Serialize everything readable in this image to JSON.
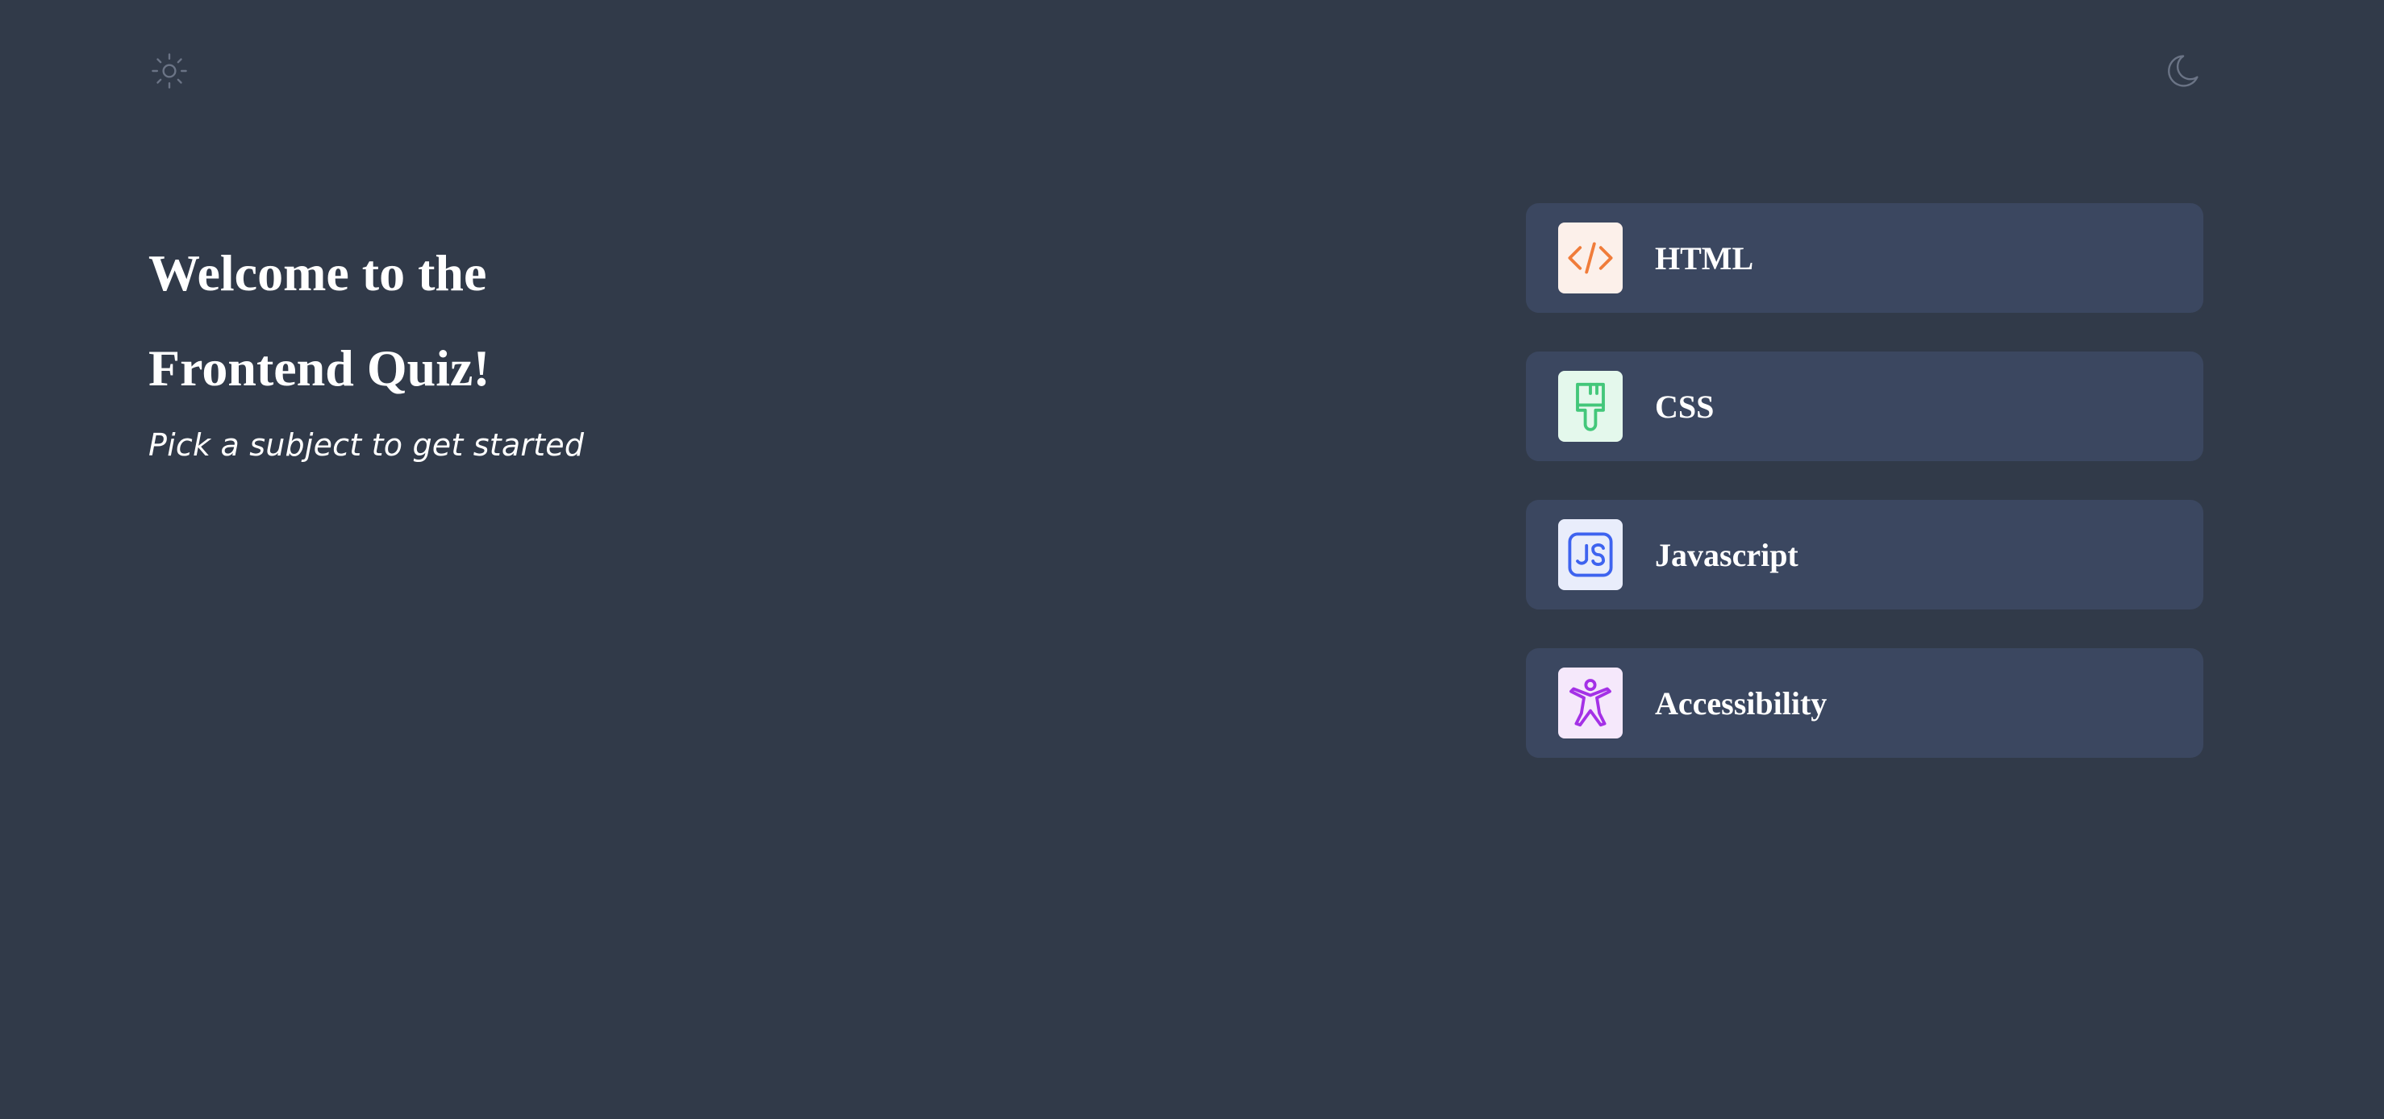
{
  "header": {
    "light_mode_icon": "sun-icon",
    "dark_mode_icon": "moon-icon"
  },
  "intro": {
    "title_line1": "Welcome to the",
    "title_line2": "Frontend Quiz!",
    "subtitle": "Pick a subject to get started"
  },
  "subjects": [
    {
      "label": "HTML",
      "icon": "code-icon",
      "accent": "#f07c3a",
      "badge_bg": "#fcf0ea"
    },
    {
      "label": "CSS",
      "icon": "paintbrush-icon",
      "accent": "#43c77a",
      "badge_bg": "#e4f8ec"
    },
    {
      "label": "Javascript",
      "icon": "js-icon",
      "accent": "#3e63ef",
      "badge_bg": "#e9edfb"
    },
    {
      "label": "Accessibility",
      "icon": "accessibility-icon",
      "accent": "#a431e6",
      "badge_bg": "#f5e8fb"
    }
  ],
  "colors": {
    "background": "#313a49",
    "card": "#3b4760",
    "text": "#ffffff",
    "theme_icon": "#6b7486"
  }
}
